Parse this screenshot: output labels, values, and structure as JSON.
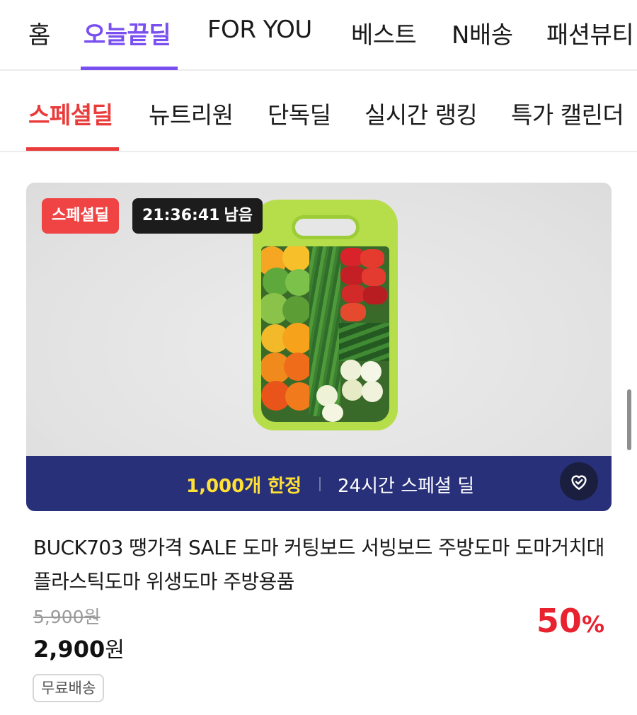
{
  "top_nav": {
    "tabs": [
      {
        "label": "홈",
        "active": false
      },
      {
        "label": "오늘끝딜",
        "active": true
      },
      {
        "label": "FOR YOU",
        "active": false
      },
      {
        "label": "베스트",
        "active": false
      },
      {
        "label": "N배송",
        "active": false
      },
      {
        "label": "패션뷰티",
        "active": false
      }
    ]
  },
  "sub_nav": {
    "tabs": [
      {
        "label": "스페셜딜",
        "active": true
      },
      {
        "label": "뉴트리원",
        "active": false
      },
      {
        "label": "단독딜",
        "active": false
      },
      {
        "label": "실시간 랭킹",
        "active": false
      },
      {
        "label": "특가 캘린더",
        "active": false
      }
    ]
  },
  "product": {
    "badge_label": "스페셜딜",
    "timer": "21:36:41",
    "timer_suffix": "남음",
    "banner": {
      "limit_text": "1,000개 한정",
      "deal_text": "24시간 스페셜 딜"
    },
    "title": "BUCK703 땡가격 SALE 도마 커팅보드 서빙보드 주방도마 도마거치대 플라스틱도마 위생도마 주방용품",
    "original_price": "5,900원",
    "sale_price_number": "2,900",
    "sale_price_unit": "원",
    "discount_number": "50",
    "discount_unit": "%",
    "shipping_tag": "무료배송"
  },
  "colors": {
    "primary_purple": "#7a4ff0",
    "deal_red": "#ea3b3b",
    "banner_navy": "#28307a",
    "banner_yellow": "#ffe135",
    "discount_red": "#e8222f"
  },
  "icons": {
    "wishlist": "heart-check-icon"
  }
}
